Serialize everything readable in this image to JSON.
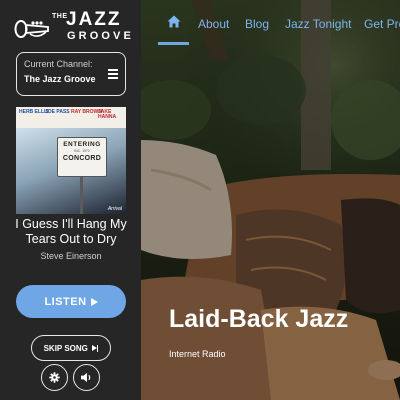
{
  "brand": {
    "the": "THE",
    "jazz": "JAZZ",
    "groove": "GROOVE"
  },
  "channel": {
    "label": "Current Channel:",
    "value": "The Jazz Groove"
  },
  "album": {
    "names": [
      "HERB ELLIS",
      "JOE PASS",
      "RAY BROWN",
      "JAKE HANNA"
    ],
    "sign_top": "ENTERING",
    "sign_mid": "INC. 1972",
    "sign_town": "CONCORD",
    "label": "Arrival"
  },
  "now_playing": {
    "title": "I Guess I'll Hang My Tears Out to Dry",
    "artist": "Steve Einerson"
  },
  "controls": {
    "listen": "LISTEN",
    "skip": "SKIP SONG"
  },
  "nav": {
    "items": [
      "About",
      "Blog",
      "Jazz Tonight",
      "Get Pre"
    ]
  },
  "hero": {
    "title": "Laid-Back Jazz",
    "subtitle": "Internet Radio"
  },
  "colors": {
    "sidebar_bg": "#262626",
    "accent": "#6ea6e6",
    "nav_link": "#7eb4ef"
  },
  "icons": [
    "trumpet-logo-icon",
    "hamburger-menu-icon",
    "play-icon",
    "skip-forward-icon",
    "gear-icon",
    "volume-icon",
    "home-icon"
  ]
}
